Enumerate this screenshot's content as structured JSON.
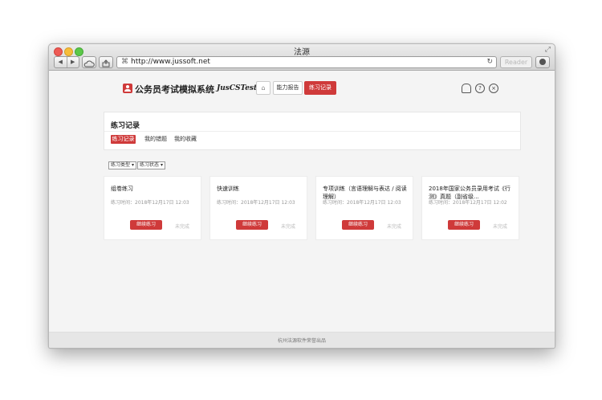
{
  "window": {
    "title": "法源",
    "url": "http://www.jussoft.net",
    "reader_label": "Reader"
  },
  "header": {
    "logo_text": "公务员考试模拟系统",
    "logo_sub": "JusCSTest",
    "nav": {
      "ability": "能力报告",
      "record": "练习记录"
    },
    "help_glyph": "?",
    "close_glyph": "×"
  },
  "panel": {
    "title": "练习记录",
    "tabs": [
      "练习记录",
      "我的错题",
      "我的收藏"
    ]
  },
  "filters": {
    "type": "练习类型",
    "status": "练习状态"
  },
  "cards": [
    {
      "title": "组卷练习",
      "time": "练习时间：2018年12月17日 12:03",
      "button": "继续练习",
      "status": "未完成"
    },
    {
      "title": "快速训练",
      "time": "练习时间：2018年12月17日 12:03",
      "button": "继续练习",
      "status": "未完成"
    },
    {
      "title": "专项训练（言语理解与表达 / 阅读理解）",
      "time": "练习时间：2018年12月17日 12:03",
      "button": "继续练习",
      "status": "未完成"
    },
    {
      "title": "2018年国家公务员录用考试《行测》真题（副省级...",
      "time": "练习时间：2018年12月17日 12:02",
      "button": "继续练习",
      "status": "未完成"
    }
  ],
  "footer": {
    "text": "杭州法源软件荣誉出品"
  },
  "icons": {
    "expand": "expand-icon",
    "lock": "url-icon",
    "reload": "reload-icon",
    "home": "home-icon",
    "user": "user-icon",
    "help": "help-icon",
    "close": "close-icon"
  },
  "colors": {
    "accent": "#cf3a3a",
    "background": "#f4f4f4"
  }
}
